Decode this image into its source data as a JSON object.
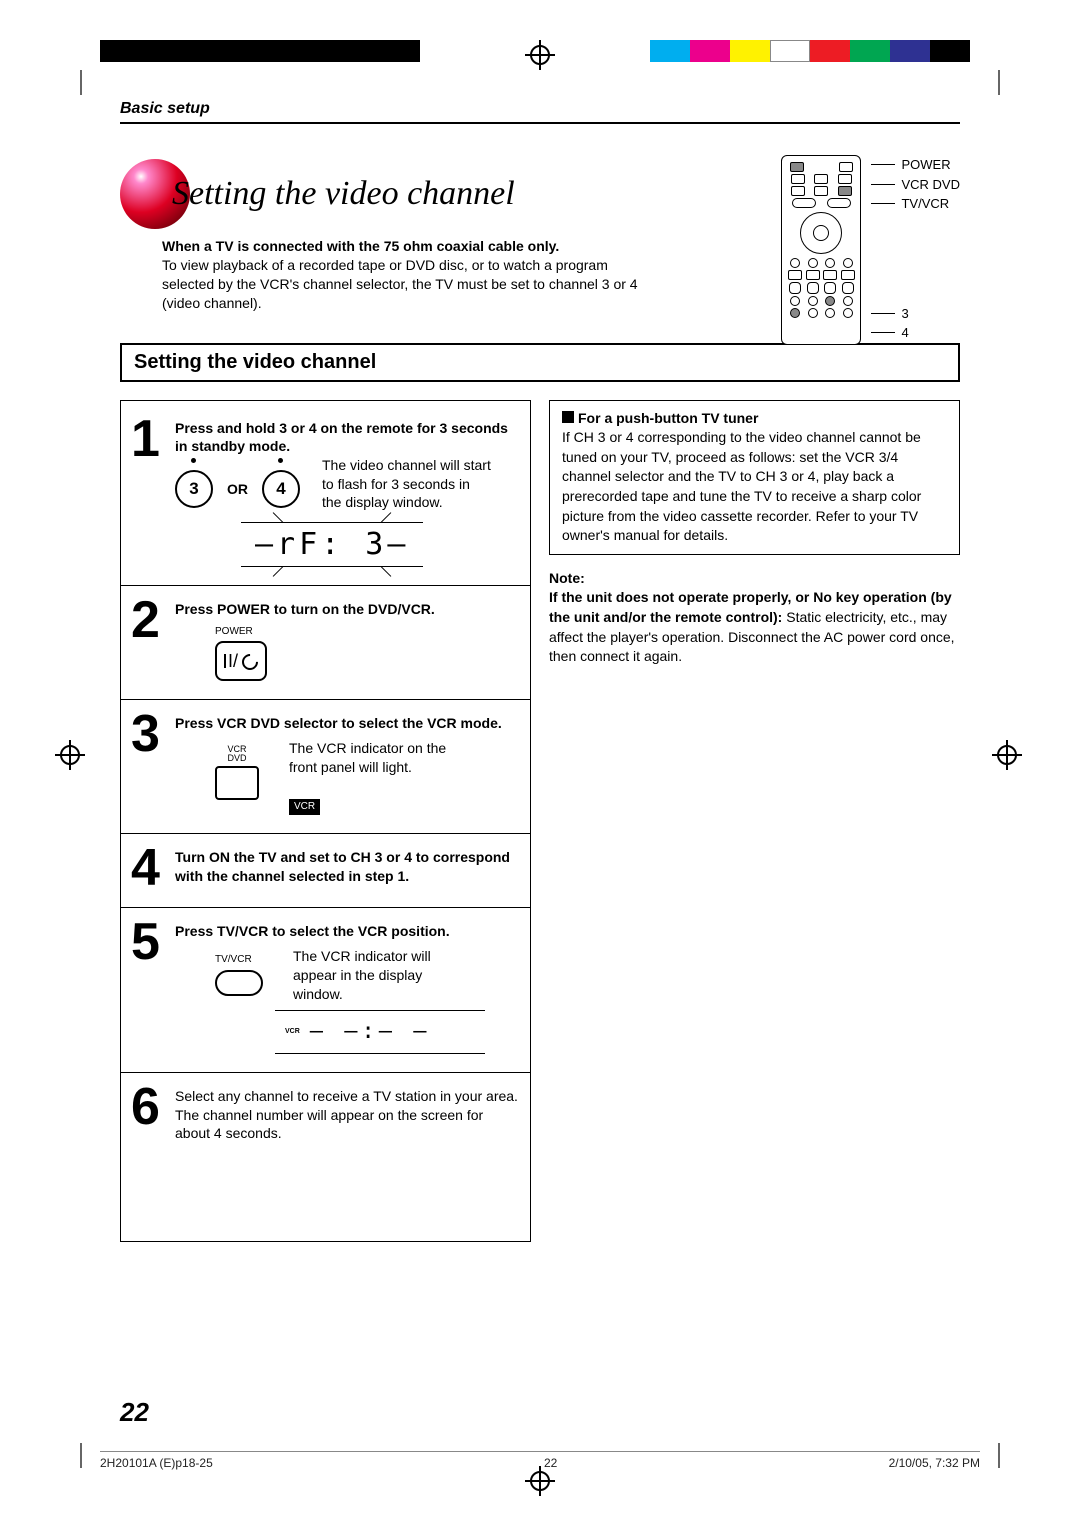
{
  "section_head": "Basic setup",
  "title": "Setting the video channel",
  "intro_bold": "When a TV is connected with the 75 ohm coaxial cable only.",
  "intro_text": "To view playback of a recorded tape or DVD disc, or to watch a program selected by the VCR's channel selector, the TV must be set to channel 3 or 4 (video channel).",
  "remote_labels": {
    "power": "POWER",
    "vcrdvd": "VCR DVD",
    "tvvcr": "TV/VCR",
    "ch3": "3",
    "ch4": "4"
  },
  "section_box": "Setting the video channel",
  "steps": {
    "s1": {
      "bold": "Press and hold 3 or 4 on the remote for 3 seconds in standby mode.",
      "or": "OR",
      "btn3": "3",
      "btn4": "4",
      "caption": "The video channel will start to flash for 3 seconds in the display window.",
      "display": "–rF: 3–"
    },
    "s2": {
      "bold": "Press POWER to turn on the DVD/VCR.",
      "power_label": "POWER",
      "power_sym": "I/"
    },
    "s3": {
      "bold": "Press VCR DVD selector to select the VCR mode.",
      "btn_label_top": "VCR",
      "btn_label_bot": "DVD",
      "caption": "The VCR indicator on the front panel will light.",
      "badge": "VCR"
    },
    "s4": {
      "bold": "Turn ON the TV and set to CH 3 or 4 to correspond with the channel selected in step 1."
    },
    "s5": {
      "bold": "Press TV/VCR to select the VCR position.",
      "btn_label": "TV/VCR",
      "caption": "The VCR indicator will appear in the display window.",
      "disp_tag": "VCR",
      "disp_dashes": "– –:– –"
    },
    "s6": {
      "text": "Select any channel to receive a TV station in your area. The channel number will appear on the screen for about 4 seconds."
    }
  },
  "tuner": {
    "head": "For a push-button TV tuner",
    "body": "If CH 3 or 4 corresponding to the video channel cannot be tuned on your TV, proceed as follows: set the VCR 3/4 channel selector and the TV to CH 3 or 4, play back a prerecorded tape and tune the TV to receive a sharp color picture from the video cassette recorder. Refer to your TV owner's manual for details."
  },
  "note": {
    "head": "Note:",
    "bold": "If the unit does not operate properly, or No key operation (by the unit and/or the remote control):",
    "rest": " Static electricity, etc., may affect the player's operation. Disconnect the AC power cord once, then connect it again."
  },
  "page_number": "22",
  "footer": {
    "file": "2H20101A (E)p18-25",
    "page": "22",
    "date": "2/10/05, 7:32 PM"
  },
  "color_bars_left": [
    "#000",
    "#000",
    "#000",
    "#000",
    "#000",
    "#000",
    "#000",
    "#000"
  ],
  "color_bars_right": [
    "#00AEEF",
    "#EC008C",
    "#FFF200",
    "#fff",
    "#ED1C24",
    "#00A651",
    "#2E3192",
    "#000"
  ]
}
